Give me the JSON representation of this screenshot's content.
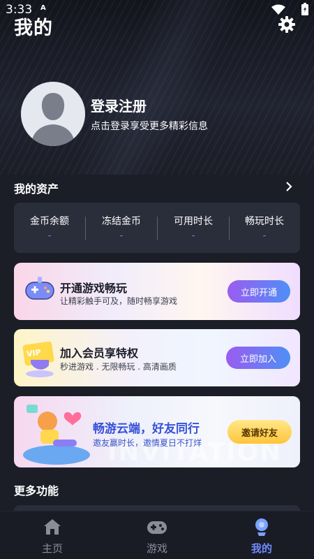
{
  "status_bar": {
    "time": "3:33",
    "notification_letter": "A"
  },
  "header": {
    "title": "我的"
  },
  "profile": {
    "title": "登录注册",
    "subtitle": "点击登录享受更多精彩信息"
  },
  "assets": {
    "title": "我的资产",
    "items": [
      {
        "label": "金币余额",
        "value": "-"
      },
      {
        "label": "冻结金币",
        "value": "-"
      },
      {
        "label": "可用时长",
        "value": "-"
      },
      {
        "label": "畅玩时长",
        "value": "-"
      }
    ]
  },
  "cards": [
    {
      "title": "开通游戏畅玩",
      "subtitle": "让精彩触手可及，随时畅享游戏",
      "button": "立即开通",
      "icon": "gamepad-icon"
    },
    {
      "title": "加入会员享特权",
      "subtitle": "秒进游戏 . 无限畅玩 . 高清画质",
      "button": "立即加入",
      "icon": "vip-card-icon",
      "badge": "VIP"
    },
    {
      "title": "畅游云端，好友同行",
      "subtitle": "邀友赢时长，邀情夏日不打烊",
      "button": "邀请好友",
      "watermark": "INVITATION"
    }
  ],
  "more": {
    "title": "更多功能"
  },
  "tabbar": {
    "items": [
      {
        "label": "主页",
        "icon": "home-icon",
        "active": false
      },
      {
        "label": "游戏",
        "icon": "gamepad-icon",
        "active": false
      },
      {
        "label": "我的",
        "icon": "profile-icon",
        "active": true
      }
    ]
  },
  "colors": {
    "accent": "#6f8bff",
    "background": "#1b1d27",
    "panel": "#2a2d3a",
    "tab_inactive": "#8a8d98"
  }
}
